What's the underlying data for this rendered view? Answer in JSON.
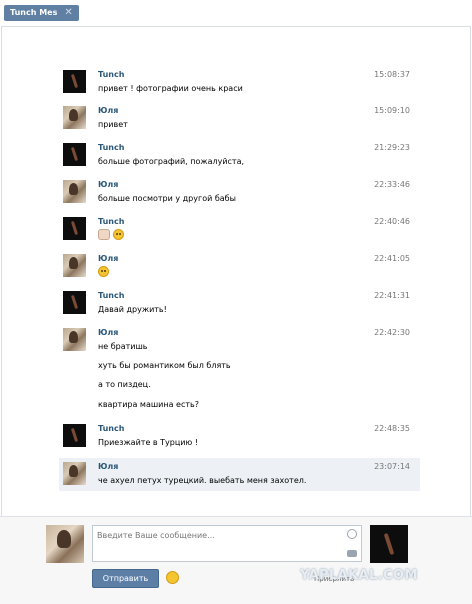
{
  "tab": {
    "title": "Tunch Mes",
    "close_glyph": "✕"
  },
  "messages": [
    {
      "author": "Tunch",
      "time": "15:08:37",
      "lines": [
        "привет ! фотографии очень краси"
      ],
      "avatar": "tunch"
    },
    {
      "author": "Юля",
      "time": "15:09:10",
      "lines": [
        "привет"
      ],
      "avatar": "yulia"
    },
    {
      "author": "Tunch",
      "time": "21:29:23",
      "lines": [
        "больше фотографий, пожалуйста,"
      ],
      "avatar": "tunch"
    },
    {
      "author": "Юля",
      "time": "22:33:46",
      "lines": [
        "больше посмотри у другой бабы"
      ],
      "avatar": "yulia"
    },
    {
      "author": "Tunch",
      "time": "22:40:46",
      "lines": [
        ""
      ],
      "avatar": "tunch",
      "emoji": [
        "hand",
        "face"
      ]
    },
    {
      "author": "Юля",
      "time": "22:41:05",
      "lines": [
        ""
      ],
      "avatar": "yulia",
      "emoji": [
        "face"
      ]
    },
    {
      "author": "Tunch",
      "time": "22:41:31",
      "lines": [
        "Давай дружить!"
      ],
      "avatar": "tunch"
    },
    {
      "author": "Юля",
      "time": "22:42:30",
      "lines": [
        "не братишь",
        "хуть бы романтиком был блять",
        "а то пиздец.",
        "квартира машина есть?"
      ],
      "avatar": "yulia"
    },
    {
      "author": "Tunch",
      "time": "22:48:35",
      "lines": [
        "Приезжайте в Турцию !"
      ],
      "avatar": "tunch"
    },
    {
      "author": "Юля",
      "time": "23:07:14",
      "lines": [
        "че ахуел петух турецкий. выебать меня захотел."
      ],
      "avatar": "yulia",
      "highlight": true
    }
  ],
  "composer": {
    "placeholder": "Введите Ваше сообщение...",
    "send_label": "Отправить",
    "smile_icon": "smile-icon",
    "camera_icon": "camera-icon"
  },
  "watermark": {
    "text": "YAPLAKAL.COM",
    "under_text": "Приерлить"
  },
  "colors": {
    "accent": "#5d7fa6",
    "author": "#2b587a",
    "highlight": "#edf1f5"
  }
}
